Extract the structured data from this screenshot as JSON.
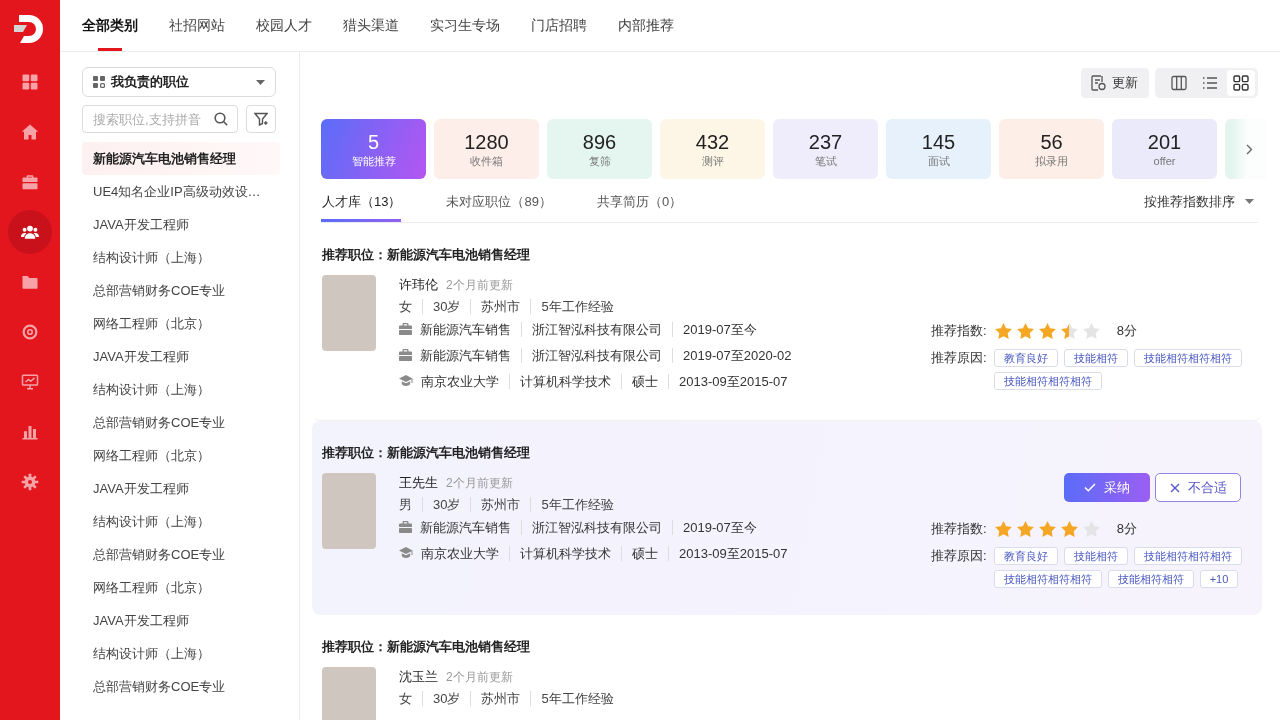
{
  "rail": {
    "items": [
      {
        "selected": false
      },
      {
        "selected": false
      },
      {
        "selected": false
      },
      {
        "selected": true
      },
      {
        "selected": false
      },
      {
        "selected": false
      },
      {
        "selected": false
      },
      {
        "selected": false
      },
      {
        "selected": false
      }
    ]
  },
  "category_tabs": [
    {
      "label": "全部类别",
      "selected": true
    },
    {
      "label": "社招网站",
      "selected": false
    },
    {
      "label": "校园人才",
      "selected": false
    },
    {
      "label": "猎头渠道",
      "selected": false
    },
    {
      "label": "实习生专场",
      "selected": false
    },
    {
      "label": "门店招聘",
      "selected": false
    },
    {
      "label": "内部推荐",
      "selected": false
    }
  ],
  "position_panel": {
    "dropdown": {
      "value": "我负责的职位"
    },
    "search": {
      "placeholder": "搜索职位,支持拼音"
    },
    "positions": [
      {
        "label": "新能源汽车电池销售经理",
        "selected": true
      },
      {
        "label": "UE4知名企业IP高级动效设…",
        "selected": false
      },
      {
        "label": "JAVA开发工程师",
        "selected": false
      },
      {
        "label": "结构设计师（上海）",
        "selected": false
      },
      {
        "label": "总部营销财务COE专业",
        "selected": false
      },
      {
        "label": "网络工程师（北京）",
        "selected": false
      },
      {
        "label": "JAVA开发工程师",
        "selected": false
      },
      {
        "label": "结构设计师（上海）",
        "selected": false
      },
      {
        "label": "总部营销财务COE专业",
        "selected": false
      },
      {
        "label": "网络工程师（北京）",
        "selected": false
      },
      {
        "label": "JAVA开发工程师",
        "selected": false
      },
      {
        "label": "结构设计师（上海）",
        "selected": false
      },
      {
        "label": "总部营销财务COE专业",
        "selected": false
      },
      {
        "label": "网络工程师（北京）",
        "selected": false
      },
      {
        "label": "JAVA开发工程师",
        "selected": false
      },
      {
        "label": "结构设计师（上海）",
        "selected": false
      },
      {
        "label": "总部营销财务COE专业",
        "selected": false
      }
    ]
  },
  "toolbar": {
    "refresh_label": "更新",
    "views": [
      {
        "selected": false
      },
      {
        "selected": false
      },
      {
        "selected": true
      }
    ]
  },
  "stage_cards": [
    {
      "count": "5",
      "label": "智能推荐",
      "color": "#5a6df8",
      "selected": true
    },
    {
      "count": "1280",
      "label": "收件箱",
      "color": "#fdeee9",
      "selected": false
    },
    {
      "count": "896",
      "label": "复筛",
      "color": "#e5f6f0",
      "selected": false
    },
    {
      "count": "432",
      "label": "测评",
      "color": "#fdf6e7",
      "selected": false
    },
    {
      "count": "237",
      "label": "笔试",
      "color": "#efecfb",
      "selected": false
    },
    {
      "count": "145",
      "label": "面试",
      "color": "#e7f1fc",
      "selected": false
    },
    {
      "count": "56",
      "label": "拟录用",
      "color": "#fdeee7",
      "selected": false
    },
    {
      "count": "201",
      "label": "offer",
      "color": "#ebeafb",
      "selected": false
    },
    {
      "color": "#e3f5ee",
      "selected": false
    }
  ],
  "result_tabs": [
    {
      "label": "人才库（13）",
      "selected": true
    },
    {
      "label": "未对应职位（89）",
      "selected": false
    },
    {
      "label": "共享简历（0）",
      "selected": false
    }
  ],
  "sort": {
    "label": "按推荐指数排序"
  },
  "candidates": [
    {
      "title": "推荐职位：新能源汽车电池销售经理",
      "name": "许玮伦",
      "updated": "2个月前更新",
      "profile": [
        "女",
        "30岁",
        "苏州市",
        "5年工作经验"
      ],
      "history": [
        {
          "kind": "work",
          "fields": [
            "新能源汽车销售",
            "浙江智泓科技有限公司",
            "2019-07至今"
          ]
        },
        {
          "kind": "work",
          "fields": [
            "新能源汽车销售",
            "浙江智泓科技有限公司",
            "2019-07至2020-02"
          ]
        },
        {
          "kind": "education",
          "fields": [
            "南京农业大学",
            "计算机科学技术",
            "硕士",
            "2013-09至2015-07"
          ]
        }
      ],
      "score_label": "推荐指数:",
      "stars": 3.5,
      "score": "8分",
      "reasons_label": "推荐原因:",
      "reasons": [
        "教育良好",
        "技能相符",
        "技能相符相符相符",
        "技能相符相符相符"
      ],
      "selected": false
    },
    {
      "title": "推荐职位：新能源汽车电池销售经理",
      "name": "王先生",
      "updated": "2个月前更新",
      "profile": [
        "男",
        "30岁",
        "苏州市",
        "5年工作经验"
      ],
      "history": [
        {
          "kind": "work",
          "fields": [
            "新能源汽车销售",
            "浙江智泓科技有限公司",
            "2019-07至今"
          ]
        },
        {
          "kind": "education",
          "fields": [
            "南京农业大学",
            "计算机科学技术",
            "硕士",
            "2013-09至2015-07"
          ]
        }
      ],
      "actions": [
        {
          "kind": "accept",
          "label": "采纳"
        },
        {
          "kind": "reject",
          "label": "不合适"
        }
      ],
      "score_label": "推荐指数:",
      "stars": 4,
      "score": "8分",
      "reasons_label": "推荐原因:",
      "reasons": [
        "教育良好",
        "技能相符",
        "技能相符相符相符",
        "技能相符相符相符",
        "技能相符相符",
        "+10"
      ],
      "selected": true
    },
    {
      "title": "推荐职位：新能源汽车电池销售经理",
      "name": "沈玉兰",
      "updated": "2个月前更新",
      "profile": [
        "女",
        "30岁",
        "苏州市",
        "5年工作经验"
      ],
      "selected": false
    }
  ]
}
